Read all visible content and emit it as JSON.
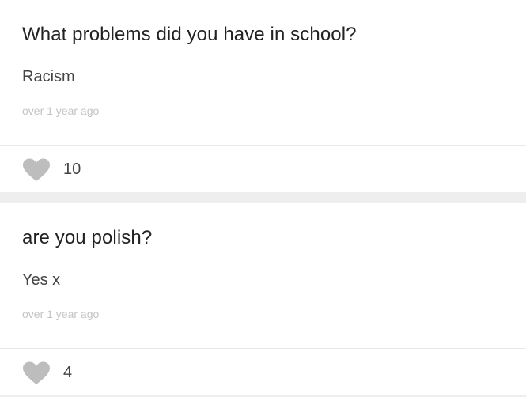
{
  "posts": [
    {
      "question": "What problems did you have in school?",
      "answer": "Racism",
      "timestamp": "over 1 year ago",
      "likes": "10",
      "like_icon": "heart-icon"
    },
    {
      "question": "are you polish?",
      "answer": "Yes x",
      "timestamp": "over 1 year ago",
      "likes": "4",
      "like_icon": "heart-icon"
    }
  ],
  "colors": {
    "background": "#eeeeee",
    "card": "#ffffff",
    "heart": "#bdbdbd",
    "question_text": "#222222",
    "answer_text": "#444444",
    "timestamp_text": "#c4c4c4"
  }
}
